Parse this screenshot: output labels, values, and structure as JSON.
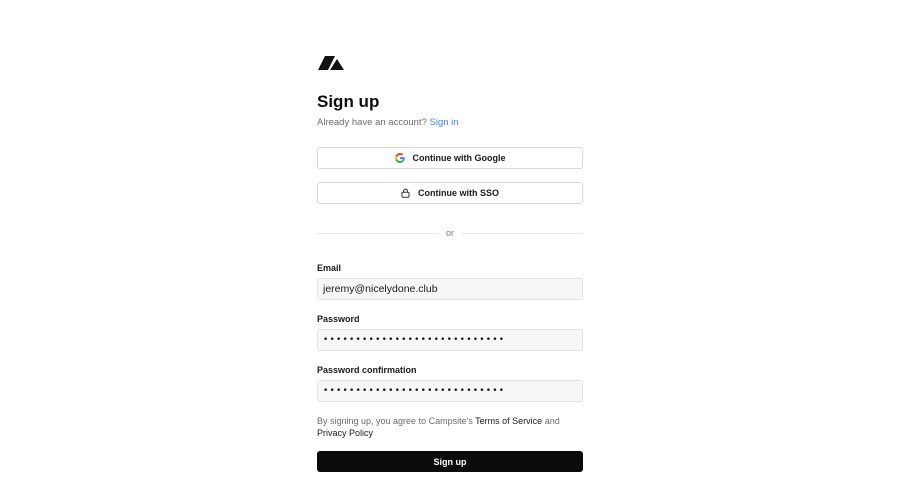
{
  "brand": {
    "logo_icon": "campsite-tent-logo-icon"
  },
  "header": {
    "title": "Sign up",
    "subtitle_prefix": "Already have an account?",
    "signin_link": "Sign in"
  },
  "oauth": {
    "google_label": "Continue with Google",
    "google_icon": "google-icon",
    "sso_label": "Continue with SSO",
    "sso_icon": "lock-icon"
  },
  "divider": {
    "label": "or"
  },
  "form": {
    "email_label": "Email",
    "email_value": "jeremy@nicelydone.club",
    "password_label": "Password",
    "password_value": "••••••••••••••••••••••••••••",
    "password_confirm_label": "Password confirmation",
    "password_confirm_value": "••••••••••••••••••••••••••••"
  },
  "terms": {
    "prefix": "By signing up, you agree to Campsite's",
    "tos_link": "Terms of Service",
    "and": "and",
    "privacy_link": "Privacy Policy"
  },
  "submit": {
    "label": "Sign up"
  },
  "colors": {
    "accent_link": "#3b82f6",
    "primary_button": "#0b0b0b",
    "input_bg": "#f7f7f7"
  }
}
